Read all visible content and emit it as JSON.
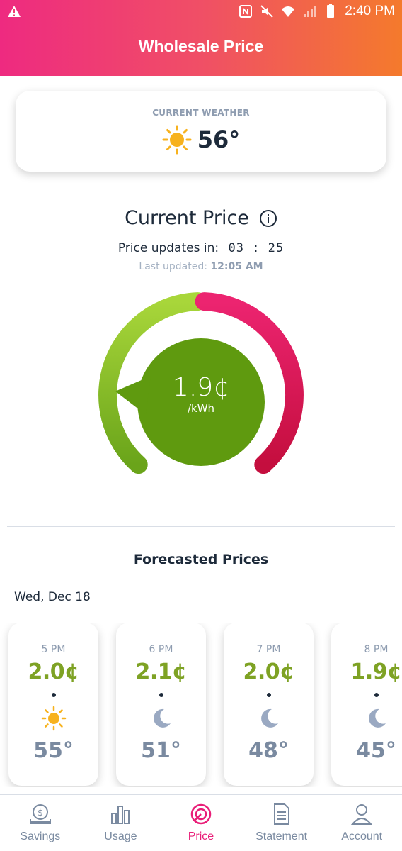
{
  "status_bar": {
    "time": "2:40 PM",
    "icons": [
      "warning-icon",
      "nfc-icon",
      "mute-icon",
      "wifi-icon",
      "signal-icon",
      "battery-icon"
    ]
  },
  "header": {
    "title": "Wholesale Price"
  },
  "weather": {
    "label": "CURRENT WEATHER",
    "temp": "56°",
    "icon": "sun-icon"
  },
  "current_price": {
    "title": "Current Price",
    "updates_label": "Price updates in:",
    "countdown": "03 : 25",
    "last_updated_label": "Last updated:",
    "last_updated_time": "12:05 AM",
    "value": "1.9¢",
    "unit": "/kWh",
    "level_fraction": 0.2,
    "colors": {
      "low": "#8dc63f",
      "high": "#e0215f",
      "bubble": "#5f9a0f"
    }
  },
  "forecast": {
    "title": "Forecasted Prices",
    "date": "Wed, Dec 18",
    "items": [
      {
        "time": "5 PM",
        "price": "2.0¢",
        "icon": "sun-icon",
        "temp": "55°"
      },
      {
        "time": "6 PM",
        "price": "2.1¢",
        "icon": "moon-icon",
        "temp": "51°"
      },
      {
        "time": "7 PM",
        "price": "2.0¢",
        "icon": "moon-icon",
        "temp": "48°"
      },
      {
        "time": "8 PM",
        "price": "1.9¢",
        "icon": "moon-icon",
        "temp": "45°"
      }
    ]
  },
  "nav": {
    "items": [
      {
        "label": "Savings",
        "icon": "savings-icon"
      },
      {
        "label": "Usage",
        "icon": "usage-icon"
      },
      {
        "label": "Price",
        "icon": "price-icon",
        "active": true
      },
      {
        "label": "Statement",
        "icon": "statement-icon"
      },
      {
        "label": "Account",
        "icon": "account-icon"
      }
    ]
  }
}
